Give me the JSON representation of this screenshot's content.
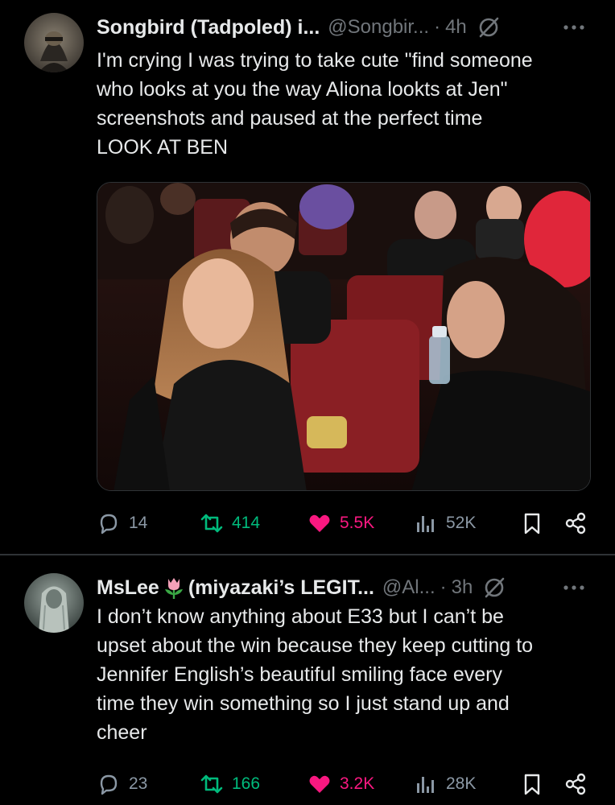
{
  "tweets": [
    {
      "name": "Songbird (Tadpoled) i...",
      "handle": "@Songbir...",
      "separator": "·",
      "time": "4h",
      "text": "I'm crying I was trying to take cute \"find someone\nwho looks at you the way Aliona lookts at Jen\"\nscreenshots and paused at the perfect time\nLOOK AT BEN",
      "has_media": true,
      "stats": {
        "replies": "14",
        "retweets": "414",
        "likes": "5.5K",
        "views": "52K"
      }
    },
    {
      "name_prefix": "MsLee",
      "name_emoji": "tulip-emoji",
      "name_suffix": "(miyazaki’s LEGIT...",
      "handle": "@Al...",
      "separator": "·",
      "time": "3h",
      "text": "I don’t know anything about E33 but I can’t be\nupset about the win because they keep cutting to\nJennifer English’s beautiful smiling face every\ntime they win something so I just stand up and\ncheer",
      "stats": {
        "replies": "23",
        "retweets": "166",
        "likes": "3.2K",
        "views": "28K"
      }
    }
  ],
  "colors": {
    "background": "#000000",
    "text": "#e7e9ea",
    "muted": "#71767b",
    "retweet": "#00ba7c",
    "like": "#f91880",
    "divider": "#2f3336"
  },
  "icons": [
    "reply-icon",
    "retweet-icon",
    "heart-icon",
    "views-icon",
    "bookmark-icon",
    "share-icon",
    "grok-icon",
    "more-icon"
  ]
}
